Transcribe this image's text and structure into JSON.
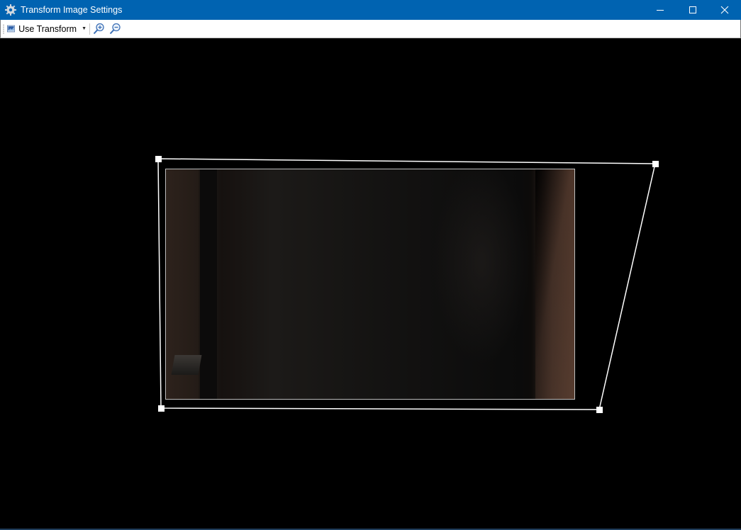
{
  "window": {
    "title": "Transform Image Settings",
    "app_icon": "gear-icon",
    "buttons": [
      "minimize-icon",
      "maximize-icon",
      "close-icon"
    ]
  },
  "toolbar": {
    "use_transform_label": "Use Transform",
    "use_transform_icon": "image-icon",
    "zoom_in_icon": "zoom-in-icon",
    "zoom_out_icon": "zoom-out-icon"
  },
  "colors": {
    "titlebar": "#0063b1",
    "canvas": "#000000",
    "frame": "#ffffff"
  }
}
